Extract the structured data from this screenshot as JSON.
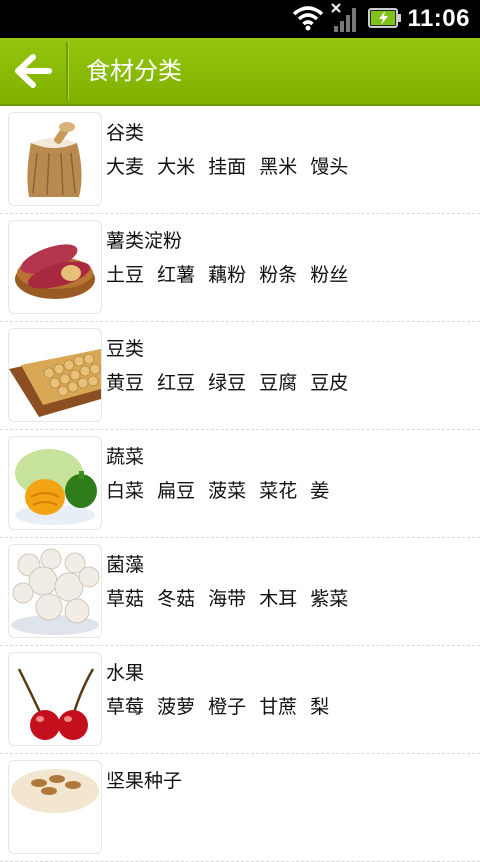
{
  "status_bar": {
    "time": "11:06"
  },
  "header": {
    "title": "食材分类"
  },
  "categories": [
    {
      "name": "谷类",
      "items": [
        "大麦",
        "大米",
        "挂面",
        "黑米",
        "馒头"
      ]
    },
    {
      "name": "薯类淀粉",
      "items": [
        "土豆",
        "红薯",
        "藕粉",
        "粉条",
        "粉丝"
      ]
    },
    {
      "name": "豆类",
      "items": [
        "黄豆",
        "红豆",
        "绿豆",
        "豆腐",
        "豆皮"
      ]
    },
    {
      "name": "蔬菜",
      "items": [
        "白菜",
        "扁豆",
        "菠菜",
        "菜花",
        "姜"
      ]
    },
    {
      "name": "菌藻",
      "items": [
        "草菇",
        "冬菇",
        "海带",
        "木耳",
        "紫菜"
      ]
    },
    {
      "name": "水果",
      "items": [
        "草莓",
        "菠萝",
        "橙子",
        "甘蔗",
        "梨"
      ]
    },
    {
      "name": "坚果种子",
      "items": []
    }
  ],
  "colors": {
    "accent": "#8cbf0a",
    "header_text": "#ffffff",
    "status_bar": "#000000"
  }
}
